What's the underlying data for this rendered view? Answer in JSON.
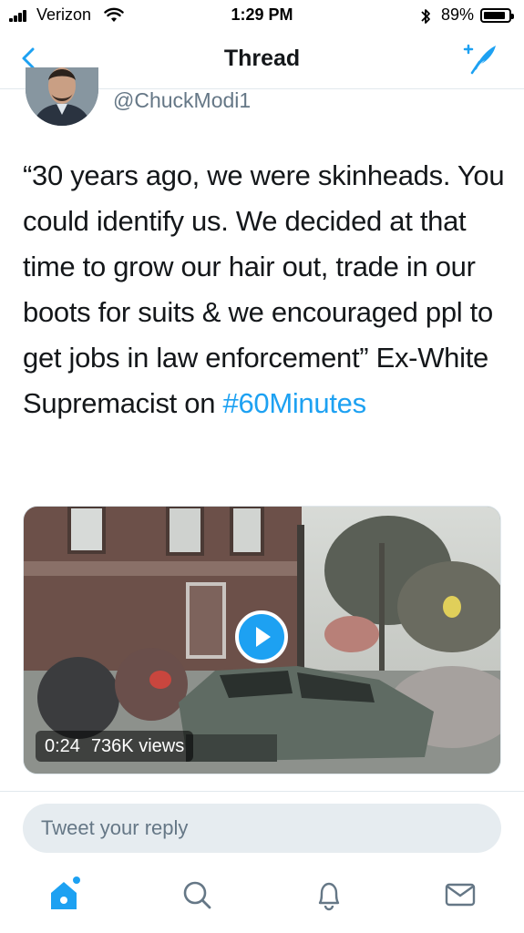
{
  "status_bar": {
    "carrier": "Verizon",
    "time": "1:29 PM",
    "battery_percent": "89%",
    "battery_level": 0.89,
    "icons": [
      "signal-icon",
      "wifi-icon",
      "bluetooth-icon",
      "battery-icon"
    ]
  },
  "nav": {
    "title": "Thread",
    "back_icon": "chevron-left-icon",
    "compose_icon": "compose-tweet-icon"
  },
  "tweet": {
    "handle": "@ChuckModi1",
    "text_main": "“30 years ago, we were skinheads. You could identify us. We decided at that time to grow our hair out, trade in our boots for suits & we encouraged ppl to get jobs in law enforcement” Ex-White Supremacist on ",
    "hashtag": "#60Minutes",
    "video": {
      "duration": "0:24",
      "views": "736K views",
      "play_icon": "play-icon"
    }
  },
  "reply": {
    "placeholder": "Tweet your reply"
  },
  "tab_bar": {
    "tabs": [
      {
        "name": "home",
        "icon": "home-icon",
        "active": true
      },
      {
        "name": "search",
        "icon": "search-icon",
        "active": false
      },
      {
        "name": "notifications",
        "icon": "bell-icon",
        "active": false
      },
      {
        "name": "messages",
        "icon": "mail-icon",
        "active": false
      }
    ]
  },
  "colors": {
    "accent": "#1da1f2",
    "text": "#14171a",
    "secondary_text": "#657786",
    "divider": "#e1e8ed",
    "input_bg": "#e6ecf0"
  }
}
